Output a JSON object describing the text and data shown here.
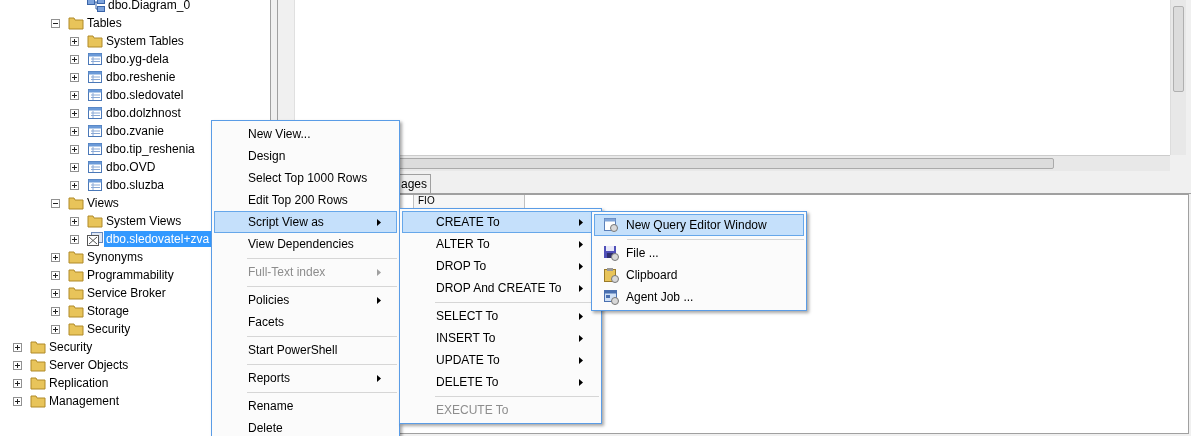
{
  "object_explorer": {
    "clipped_branch": [
      {
        "label": "dbo.Diagram_0",
        "kind": "diagram",
        "selected": false
      }
    ],
    "database_nodes": [
      {
        "label": "Tables",
        "kind": "folder",
        "expanded": true,
        "selected": false,
        "children": [
          {
            "label": "System Tables",
            "kind": "folder",
            "expanded": false,
            "selected": false
          },
          {
            "label": "dbo.yg-dela",
            "kind": "table",
            "expanded": false,
            "selected": false
          },
          {
            "label": "dbo.reshenie",
            "kind": "table",
            "expanded": false,
            "selected": false
          },
          {
            "label": "dbo.sledovatel",
            "kind": "table",
            "expanded": false,
            "selected": false
          },
          {
            "label": "dbo.dolzhnost",
            "kind": "table",
            "expanded": false,
            "selected": false
          },
          {
            "label": "dbo.zvanie",
            "kind": "table",
            "expanded": false,
            "selected": false
          },
          {
            "label": "dbo.tip_reshenia",
            "kind": "table",
            "expanded": false,
            "selected": false
          },
          {
            "label": "dbo.OVD",
            "kind": "table",
            "expanded": false,
            "selected": false
          },
          {
            "label": "dbo.sluzba",
            "kind": "table",
            "expanded": false,
            "selected": false
          }
        ]
      },
      {
        "label": "Views",
        "kind": "folder",
        "expanded": true,
        "selected": false,
        "children": [
          {
            "label": "System Views",
            "kind": "folder",
            "expanded": false,
            "selected": false
          },
          {
            "label": "dbo.sledovatel+zva",
            "kind": "view",
            "expanded": false,
            "selected": true
          }
        ]
      },
      {
        "label": "Synonyms",
        "kind": "folder",
        "expanded": false,
        "selected": false
      },
      {
        "label": "Programmability",
        "kind": "folder",
        "expanded": false,
        "selected": false
      },
      {
        "label": "Service Broker",
        "kind": "folder",
        "expanded": false,
        "selected": false
      },
      {
        "label": "Storage",
        "kind": "folder",
        "expanded": false,
        "selected": false
      },
      {
        "label": "Security",
        "kind": "folder",
        "expanded": false,
        "selected": false
      }
    ],
    "server_nodes": [
      {
        "label": "Security",
        "kind": "folder",
        "expanded": false,
        "selected": false
      },
      {
        "label": "Server Objects",
        "kind": "folder",
        "expanded": false,
        "selected": false
      },
      {
        "label": "Replication",
        "kind": "folder",
        "expanded": false,
        "selected": false
      },
      {
        "label": "Management",
        "kind": "folder",
        "expanded": false,
        "selected": false
      }
    ]
  },
  "results_pane": {
    "tab": {
      "label": "ages",
      "selected": false
    },
    "columns": [
      "FIO"
    ]
  },
  "context_menu": [
    {
      "kind": "item",
      "label": "New View...",
      "submenu": false,
      "disabled": false,
      "selected": false
    },
    {
      "kind": "item",
      "label": "Design",
      "submenu": false,
      "disabled": false,
      "selected": false
    },
    {
      "kind": "item",
      "label": "Select Top 1000 Rows",
      "submenu": false,
      "disabled": false,
      "selected": false
    },
    {
      "kind": "item",
      "label": "Edit Top 200 Rows",
      "submenu": false,
      "disabled": false,
      "selected": false
    },
    {
      "kind": "item",
      "label": "Script View as",
      "submenu": true,
      "disabled": false,
      "selected": true
    },
    {
      "kind": "item",
      "label": "View Dependencies",
      "submenu": false,
      "disabled": false,
      "selected": false
    },
    {
      "kind": "separator"
    },
    {
      "kind": "item",
      "label": "Full-Text index",
      "submenu": true,
      "disabled": true,
      "selected": false
    },
    {
      "kind": "separator"
    },
    {
      "kind": "item",
      "label": "Policies",
      "submenu": true,
      "disabled": false,
      "selected": false
    },
    {
      "kind": "item",
      "label": "Facets",
      "submenu": false,
      "disabled": false,
      "selected": false
    },
    {
      "kind": "separator"
    },
    {
      "kind": "item",
      "label": "Start PowerShell",
      "submenu": false,
      "disabled": false,
      "selected": false
    },
    {
      "kind": "separator"
    },
    {
      "kind": "item",
      "label": "Reports",
      "submenu": true,
      "disabled": false,
      "selected": false
    },
    {
      "kind": "separator"
    },
    {
      "kind": "item",
      "label": "Rename",
      "submenu": false,
      "disabled": false,
      "selected": false
    },
    {
      "kind": "item",
      "label": "Delete",
      "submenu": false,
      "disabled": false,
      "selected": false
    }
  ],
  "script_submenu": [
    {
      "kind": "item",
      "label": "CREATE To",
      "submenu": true,
      "disabled": false,
      "selected": true
    },
    {
      "kind": "item",
      "label": "ALTER To",
      "submenu": true,
      "disabled": false,
      "selected": false
    },
    {
      "kind": "item",
      "label": "DROP To",
      "submenu": true,
      "disabled": false,
      "selected": false
    },
    {
      "kind": "item",
      "label": "DROP And CREATE To",
      "submenu": true,
      "disabled": false,
      "selected": false
    },
    {
      "kind": "separator"
    },
    {
      "kind": "item",
      "label": "SELECT To",
      "submenu": true,
      "disabled": false,
      "selected": false
    },
    {
      "kind": "item",
      "label": "INSERT To",
      "submenu": true,
      "disabled": false,
      "selected": false
    },
    {
      "kind": "item",
      "label": "UPDATE To",
      "submenu": true,
      "disabled": false,
      "selected": false
    },
    {
      "kind": "item",
      "label": "DELETE To",
      "submenu": true,
      "disabled": false,
      "selected": false
    },
    {
      "kind": "separator"
    },
    {
      "kind": "item",
      "label": "EXECUTE To",
      "submenu": false,
      "disabled": true,
      "selected": false
    }
  ],
  "target_submenu": [
    {
      "kind": "item",
      "label": "New Query Editor Window",
      "submenu": false,
      "disabled": false,
      "selected": true
    },
    {
      "kind": "separator"
    },
    {
      "kind": "item",
      "label": "File ...",
      "submenu": false,
      "disabled": false,
      "selected": false
    },
    {
      "kind": "item",
      "label": "Clipboard",
      "submenu": false,
      "disabled": false,
      "selected": false
    },
    {
      "kind": "item",
      "label": "Agent Job ...",
      "submenu": false,
      "disabled": false,
      "selected": false
    }
  ]
}
